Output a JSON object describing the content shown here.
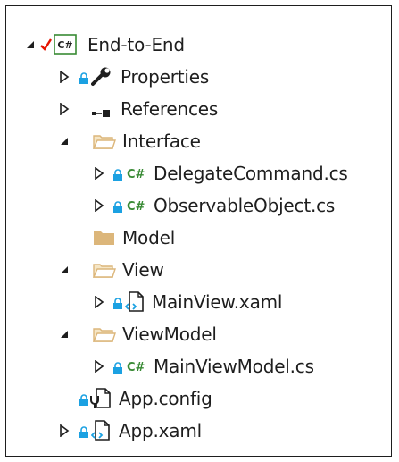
{
  "solution_explorer": {
    "items": [
      {
        "label": "End-to-End",
        "kind": "project",
        "state": "expanded",
        "icon": "csharp-project-icon",
        "checked": true
      },
      {
        "label": "Properties",
        "kind": "properties",
        "state": "collapsed",
        "icon": "wrench-icon",
        "locked": true
      },
      {
        "label": "References",
        "kind": "references",
        "state": "collapsed",
        "icon": "references-icon"
      },
      {
        "label": "Interface",
        "kind": "folder",
        "state": "expanded",
        "icon": "folder-open-icon"
      },
      {
        "label": "DelegateCommand.cs",
        "kind": "cs-file",
        "state": "collapsed",
        "icon": "csharp-file-icon",
        "locked": true
      },
      {
        "label": "ObservableObject.cs",
        "kind": "cs-file",
        "state": "collapsed",
        "icon": "csharp-file-icon",
        "locked": true
      },
      {
        "label": "Model",
        "kind": "folder",
        "state": "none",
        "icon": "folder-closed-icon"
      },
      {
        "label": "View",
        "kind": "folder",
        "state": "expanded",
        "icon": "folder-open-icon"
      },
      {
        "label": "MainView.xaml",
        "kind": "xaml-file",
        "state": "collapsed",
        "icon": "xaml-file-icon",
        "locked": true
      },
      {
        "label": "ViewModel",
        "kind": "folder",
        "state": "expanded",
        "icon": "folder-open-icon"
      },
      {
        "label": "MainViewModel.cs",
        "kind": "cs-file",
        "state": "collapsed",
        "icon": "csharp-file-icon",
        "locked": true
      },
      {
        "label": "App.config",
        "kind": "config-file",
        "state": "none",
        "icon": "config-file-icon",
        "locked": true
      },
      {
        "label": "App.xaml",
        "kind": "xaml-file",
        "state": "collapsed",
        "icon": "xaml-file-icon",
        "locked": true
      }
    ],
    "csharp_glyph": "C#",
    "colors": {
      "text": "#1e1e1e",
      "csharp_green": "#388a34",
      "lock_blue": "#1ba1e2",
      "folder": "#dcb67a",
      "check_red": "#e51400"
    }
  }
}
